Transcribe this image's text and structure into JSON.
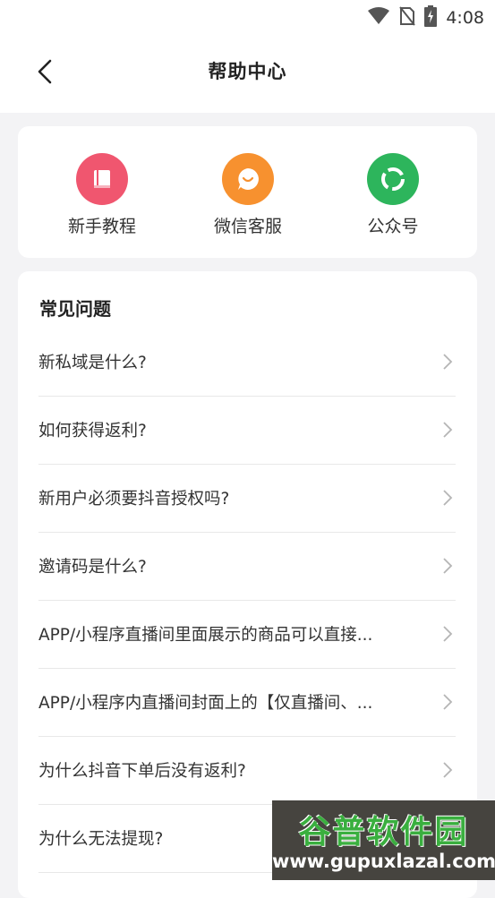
{
  "status_bar": {
    "time": "4:08",
    "icons": [
      "wifi-icon",
      "no-sim-icon",
      "battery-charging-icon"
    ]
  },
  "header": {
    "title": "帮助中心",
    "back_icon": "chevron-left-icon"
  },
  "quick_links": [
    {
      "label": "新手教程",
      "icon": "book-icon",
      "color": "#f0566f"
    },
    {
      "label": "微信客服",
      "icon": "chat-bubble-icon",
      "color": "#f7912f"
    },
    {
      "label": "公众号",
      "icon": "official-account-icon",
      "color": "#2db55c"
    }
  ],
  "faq": {
    "heading": "常见问题",
    "items": [
      "新私域是什么?",
      "如何获得返利?",
      "新用户必须要抖音授权吗?",
      "邀请码是什么?",
      "APP/小程序直播间里面展示的商品可以直接...",
      "APP/小程序内直播间封面上的【仅直播间、...",
      "为什么抖音下单后没有返利?",
      "为什么无法提现?"
    ]
  },
  "watermark": {
    "name": "谷普软件园",
    "url": "www.gupuxlazal.com"
  }
}
